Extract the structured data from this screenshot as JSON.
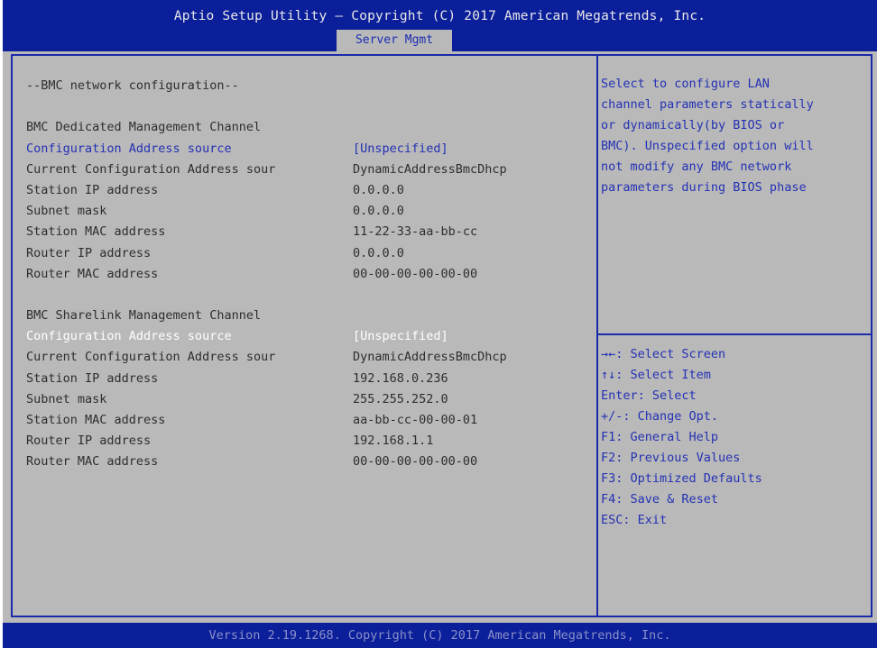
{
  "header": {
    "title": "Aptio Setup Utility – Copyright (C) 2017 American Megatrends, Inc.",
    "tab": "Server Mgmt"
  },
  "main": {
    "section_title": "--BMC network configuration--",
    "dedicated": {
      "heading": "BMC Dedicated Management Channel",
      "rows": [
        {
          "label": "Configuration Address source",
          "value": "[Unspecified]"
        },
        {
          "label": "Current Configuration Address sour",
          "value": "DynamicAddressBmcDhcp"
        },
        {
          "label": "Station IP address",
          "value": "0.0.0.0"
        },
        {
          "label": "Subnet mask",
          "value": "0.0.0.0"
        },
        {
          "label": "Station MAC address",
          "value": "11-22-33-aa-bb-cc"
        },
        {
          "label": "Router IP address",
          "value": "0.0.0.0"
        },
        {
          "label": "Router MAC address",
          "value": "00-00-00-00-00-00"
        }
      ]
    },
    "sharelink": {
      "heading": "BMC Sharelink Management Channel",
      "rows": [
        {
          "label": "Configuration Address source",
          "value": "[Unspecified]"
        },
        {
          "label": "Current Configuration Address sour",
          "value": "DynamicAddressBmcDhcp"
        },
        {
          "label": "Station IP address",
          "value": "192.168.0.236"
        },
        {
          "label": "Subnet mask",
          "value": "255.255.252.0"
        },
        {
          "label": "Station MAC address",
          "value": "aa-bb-cc-00-00-01"
        },
        {
          "label": "Router IP address",
          "value": "192.168.1.1"
        },
        {
          "label": "Router MAC address",
          "value": "00-00-00-00-00-00"
        }
      ]
    }
  },
  "help": {
    "lines": [
      "Select to configure LAN",
      "channel parameters statically",
      "or dynamically(by BIOS or",
      "BMC). Unspecified option will",
      "not modify any BMC network",
      "parameters during BIOS phase"
    ]
  },
  "keys": [
    "→←: Select Screen",
    "↑↓: Select Item",
    "Enter: Select",
    "+/-: Change Opt.",
    "F1: General Help",
    "F2: Previous Values",
    "F3: Optimized Defaults",
    "F4: Save & Reset",
    "ESC: Exit"
  ],
  "footer": {
    "text": "Version 2.19.1268. Copyright (C) 2017 American Megatrends, Inc."
  },
  "colors": {
    "header_bg": "#0b1f9a",
    "panel_bg": "#b9b9b9",
    "accent_blue": "#2431b4",
    "selected_text": "#ffffff",
    "static_text": "#2e2e2e"
  }
}
